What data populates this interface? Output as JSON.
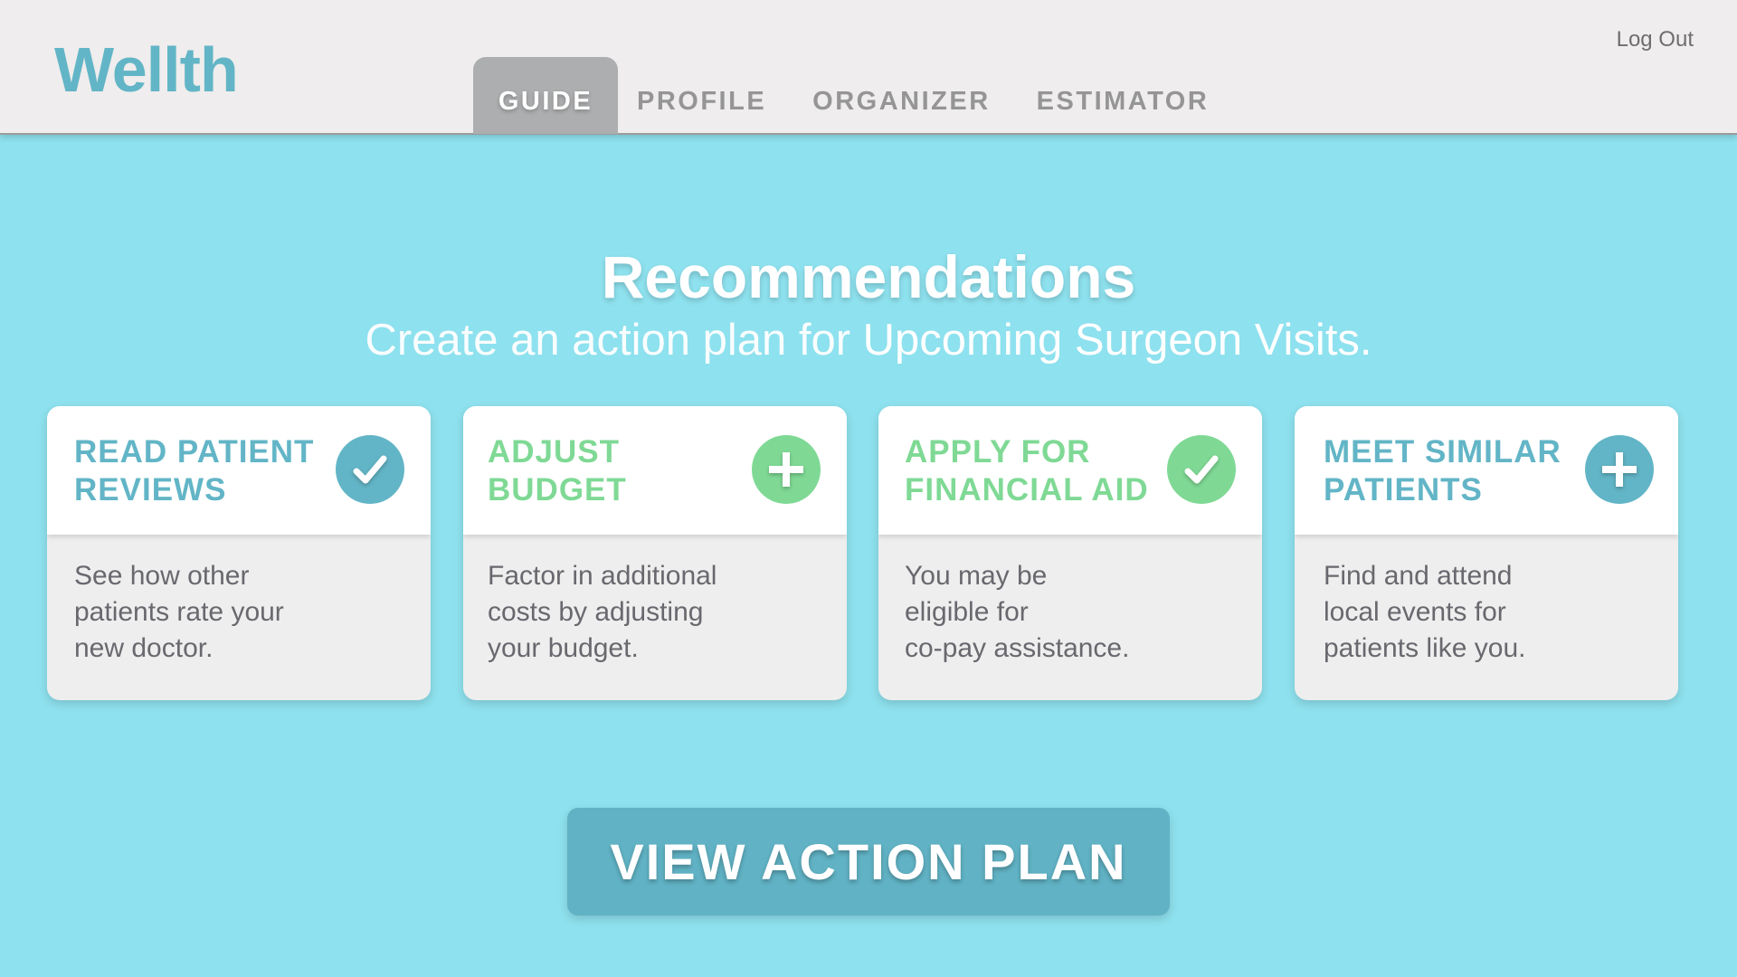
{
  "header": {
    "logo": "Wellth",
    "logout_label": "Log Out",
    "tabs": [
      {
        "label": "GUIDE",
        "active": true
      },
      {
        "label": "PROFILE",
        "active": false
      },
      {
        "label": "ORGANIZER",
        "active": false
      },
      {
        "label": "ESTIMATOR",
        "active": false
      }
    ]
  },
  "main": {
    "title": "Recommendations",
    "subtitle_prefix": "Create an action plan for ",
    "subtitle_emphasis": "Upcoming Surgeon Visits."
  },
  "cards": [
    {
      "title": "READ PATIENT REVIEWS",
      "description": "See how other\npatients rate your\nnew doctor.",
      "icon": "check-icon",
      "color": "#62b5c6"
    },
    {
      "title": "ADJUST BUDGET",
      "description": "Factor in additional\ncosts by adjusting\nyour budget.",
      "icon": "plus-icon",
      "color": "#7fd995"
    },
    {
      "title": "APPLY FOR FINANCIAL AID",
      "description": "You may be\neligible for\nco-pay assistance.",
      "icon": "check-icon",
      "color": "#7fd995"
    },
    {
      "title": "MEET SIMILAR PATIENTS",
      "description": "Find and attend\nlocal events for\npatients like you.",
      "icon": "plus-icon",
      "color": "#62b5c6"
    }
  ],
  "cta": {
    "label": "VIEW ACTION PLAN"
  },
  "theme": {
    "background": "#8ee1ee",
    "header_bg": "#efeded",
    "teal": "#62b5c6",
    "green": "#7fd995",
    "active_tab": "#adaeaf"
  }
}
